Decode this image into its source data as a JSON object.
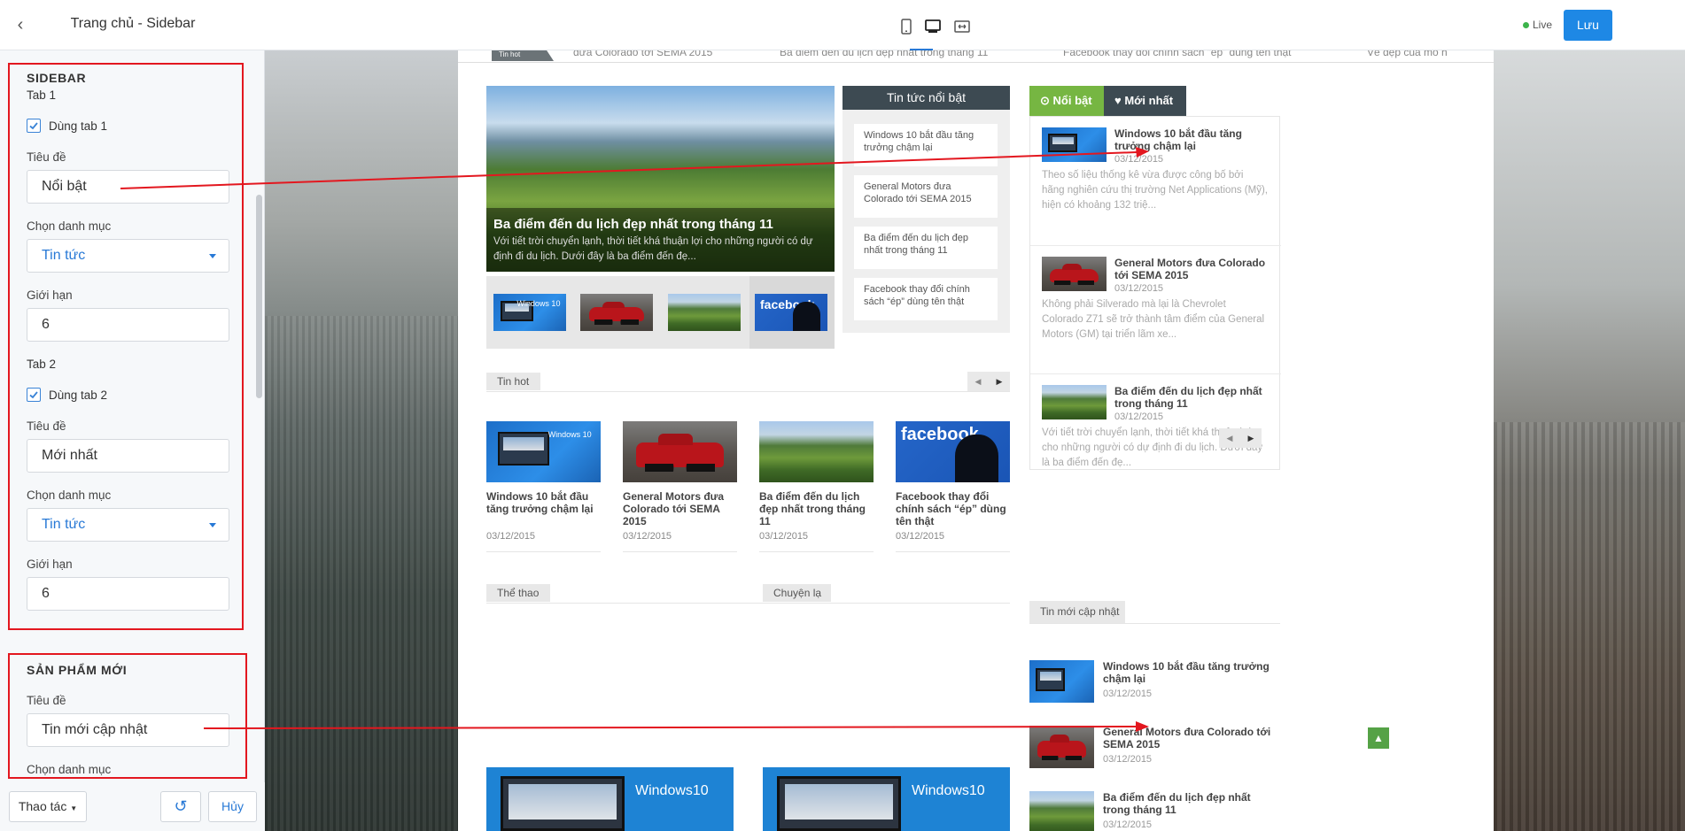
{
  "panel": {
    "title": "Trang chủ - Sidebar",
    "sidebar_section": {
      "heading": "SIDEBAR",
      "tab1": {
        "heading": "Tab 1",
        "use_label": "Dùng tab 1",
        "checked": true,
        "title_label": "Tiêu đề",
        "title_value": "Nổi bật",
        "category_label": "Chọn danh mục",
        "category_value": "Tin tức",
        "limit_label": "Giới hạn",
        "limit_value": "6"
      },
      "tab2": {
        "heading": "Tab 2",
        "use_label": "Dùng tab 2",
        "checked": true,
        "title_label": "Tiêu đề",
        "title_value": "Mới nhất",
        "category_label": "Chọn danh mục",
        "category_value": "Tin tức",
        "limit_label": "Giới hạn",
        "limit_value": "6"
      }
    },
    "new_products_section": {
      "heading": "SẢN PHẨM MỚI",
      "title_label": "Tiêu đề",
      "title_value": "Tin mới cập nhật",
      "category_label": "Chọn danh mục"
    },
    "footer": {
      "actions_label": "Thao tác",
      "cancel_label": "Hủy"
    }
  },
  "topbar": {
    "live_label": "Live",
    "save_label": "Lưu",
    "devices": [
      "mobile-icon",
      "desktop-icon",
      "fullwidth-icon"
    ],
    "active_device": "desktop-icon",
    "accent": "#1e88e5"
  },
  "preview": {
    "ticker": {
      "tag": "Tin hot",
      "items": [
        "đưa Colorado tới SEMA 2015",
        "Ba điểm đến du lịch đẹp nhất trong tháng 11",
        "Facebook thay đổi chính sách “ép” dùng tên thật",
        "Vẻ đẹp của mô h"
      ]
    },
    "hero": {
      "title": "Ba điểm đến du lịch đẹp nhất trong tháng 11",
      "desc": "Với tiết trời chuyển lạnh, thời tiết khá thuận lợi cho những người có dự định đi du lịch. Dưới đây là ba điểm đến đẹ..."
    },
    "featured": {
      "heading": "Tin tức nổi bật",
      "items": [
        "Windows 10 bắt đầu tăng trưởng chậm lại",
        "General Motors đưa Colorado tới SEMA 2015",
        "Ba điểm đến du lịch đẹp nhất trong tháng 11",
        "Facebook thay đổi chính sách “ép” dùng tên thật"
      ]
    },
    "hot": {
      "heading": "Tin hot",
      "items": [
        {
          "title": "Windows 10 bắt đầu tăng trưởng chậm lại",
          "date": "03/12/2015"
        },
        {
          "title": "General Motors đưa Colorado tới SEMA 2015",
          "date": "03/12/2015"
        },
        {
          "title": "Ba điểm đến du lịch đẹp nhất trong tháng 11",
          "date": "03/12/2015"
        },
        {
          "title": "Facebook thay đổi chính sách “ép” dùng tên thật",
          "date": "03/12/2015"
        }
      ]
    },
    "categories": {
      "sport": "Thể thao",
      "strange": "Chuyện lạ",
      "win_logo": "Windows10"
    },
    "thumb_labels": {
      "facebook": "facebook",
      "windows": "Windows 10"
    },
    "tabs": {
      "tab1_label": "Nổi bật",
      "tab2_label": "Mới nhất",
      "items": [
        {
          "title": "Windows 10 bắt đầu tăng trưởng chậm lại",
          "date": "03/12/2015",
          "desc": "Theo số liệu thống kê vừa được công bố bởi hãng nghiên cứu thị trường Net Applications (Mỹ), hiện có khoảng 132 triệ..."
        },
        {
          "title": "General Motors đưa Colorado tới SEMA 2015",
          "date": "03/12/2015",
          "desc": "Không phải Silverado mà lại là Chevrolet Colorado Z71 sẽ trở thành tâm điểm của General Motors (GM) tại triển lãm xe..."
        },
        {
          "title": "Ba điểm đến du lịch đẹp nhất trong tháng 11",
          "date": "03/12/2015",
          "desc": "Với tiết trời chuyển lạnh, thời tiết khá thuận lợi cho những người có dự định đi du lịch. Dưới đây là ba điểm đến đẹ..."
        }
      ]
    },
    "newest": {
      "heading": "Tin mới cập nhật",
      "items": [
        {
          "title": "Windows 10 bắt đầu tăng trưởng chậm lại",
          "date": "03/12/2015"
        },
        {
          "title": "General Motors đưa Colorado tới SEMA 2015",
          "date": "03/12/2015"
        },
        {
          "title": "Ba điểm đến du lịch đẹp nhất trong tháng 11",
          "date": "03/12/2015"
        }
      ]
    }
  }
}
